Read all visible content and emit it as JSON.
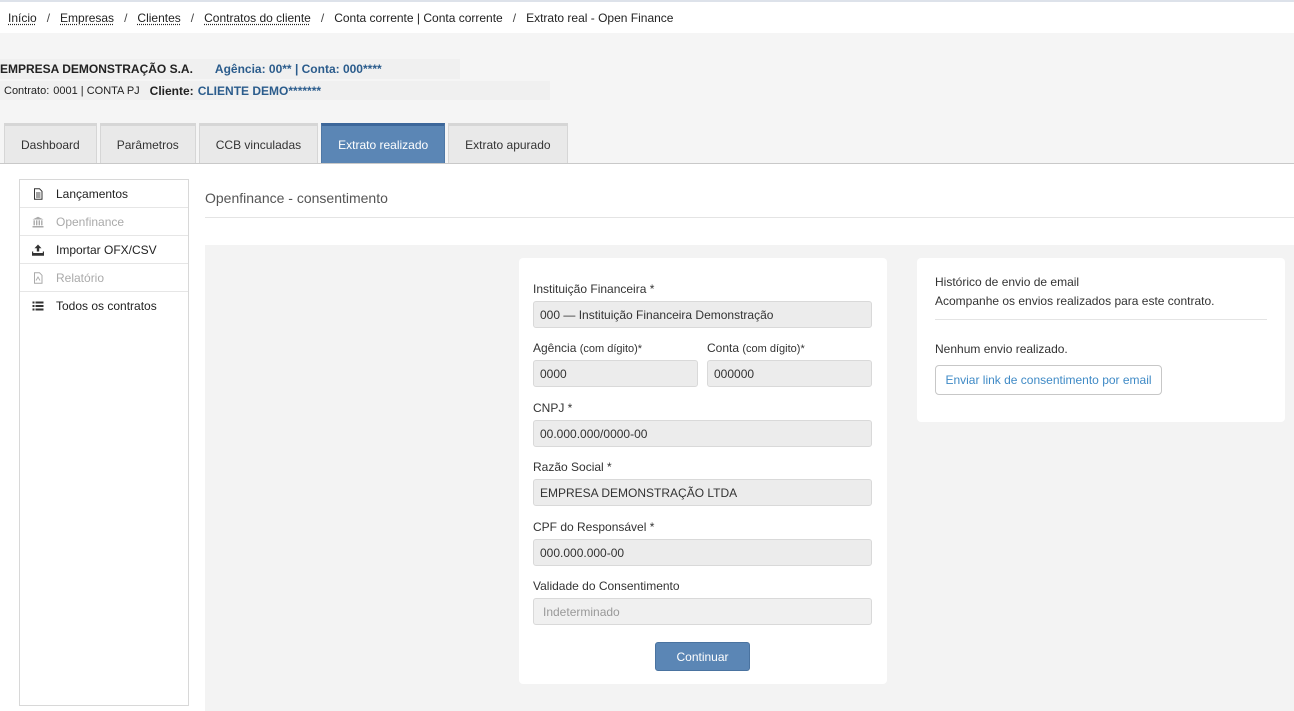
{
  "breadcrumb": {
    "items": [
      "Início",
      "Empresas",
      "Clientes",
      "Contratos do cliente",
      "Conta corrente | Conta corrente",
      "Extrato real - Open Finance"
    ],
    "separator": "/"
  },
  "header": {
    "company_name": "EMPRESA DEMONSTRAÇÃO S.A.",
    "account_info": "Agência: 00** | Conta: 000****",
    "contract_label": "Contrato:",
    "contract_value": "0001 | CONTA PJ",
    "client_label": "Cliente:",
    "client_value": "CLIENTE DEMO*******"
  },
  "tabs": [
    {
      "label": "Dashboard",
      "active": false
    },
    {
      "label": "Parâmetros",
      "active": false
    },
    {
      "label": "CCB vinculadas",
      "active": false
    },
    {
      "label": "Extrato realizado",
      "active": true
    },
    {
      "label": "Extrato apurado",
      "active": false
    }
  ],
  "sidebar": {
    "items": [
      {
        "label": "Lançamentos",
        "icon": "document-icon",
        "disabled": false
      },
      {
        "label": "Openfinance",
        "icon": "bank-icon",
        "disabled": true
      },
      {
        "label": "Importar OFX/CSV",
        "icon": "upload-icon",
        "disabled": false
      },
      {
        "label": "Relatório",
        "icon": "pdf-icon",
        "disabled": true
      },
      {
        "label": "Todos os contratos",
        "icon": "list-icon",
        "disabled": false
      }
    ]
  },
  "section": {
    "title": "Openfinance - consentimento"
  },
  "form": {
    "instituicao_label": "Instituição Financeira *",
    "instituicao_value": "000 — Instituição Financeira Demonstração",
    "agencia_label": "Agência",
    "agencia_hint": "(com dígito)*",
    "agencia_value": "0000",
    "conta_label": "Conta",
    "conta_hint": "(com dígito)*",
    "conta_value": "000000",
    "cnpj_label": "CNPJ *",
    "cnpj_value": "00.000.000/0000-00",
    "razao_label": "Razão Social *",
    "razao_value": "EMPRESA DEMONSTRAÇÃO LTDA",
    "cpf_label": "CPF do Responsável *",
    "cpf_value": "000.000.000-00",
    "validade_label": "Validade do Consentimento",
    "validade_placeholder": "Indeterminado",
    "continue_label": "Continuar"
  },
  "history": {
    "title": "Histórico de envio de email",
    "subtitle": "Acompanhe os envios realizados para este contrato.",
    "empty_text": "Nenhum envio realizado.",
    "send_button_label": "Enviar link de consentimento por email"
  },
  "colors": {
    "accent": "#5b86b5",
    "link_blue": "#2b5c8c",
    "outline_button_text": "#3f8ac6"
  }
}
